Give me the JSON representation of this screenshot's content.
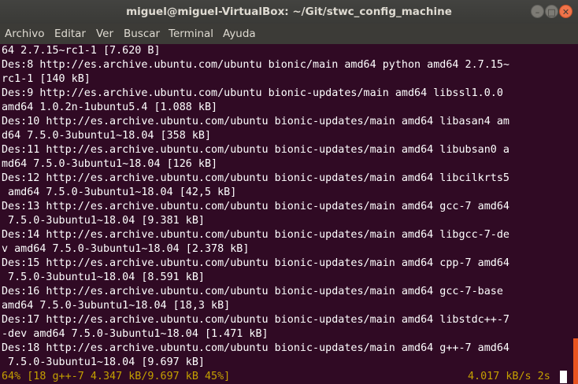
{
  "window": {
    "title": "miguel@miguel-VirtualBox: ~/Git/stwc_config_machine"
  },
  "window_controls": {
    "minimize_glyph": "–",
    "maximize_glyph": "□",
    "close_glyph": "✕"
  },
  "menubar": {
    "items": [
      "Archivo",
      "Editar",
      "Ver",
      "Buscar",
      "Terminal",
      "Ayuda"
    ]
  },
  "terminal": {
    "lines": [
      "64 2.7.15~rc1-1 [7.620 B]",
      "Des:8 http://es.archive.ubuntu.com/ubuntu bionic/main amd64 python amd64 2.7.15~",
      "rc1-1 [140 kB]",
      "Des:9 http://es.archive.ubuntu.com/ubuntu bionic-updates/main amd64 libssl1.0.0",
      "amd64 1.0.2n-1ubuntu5.4 [1.088 kB]",
      "Des:10 http://es.archive.ubuntu.com/ubuntu bionic-updates/main amd64 libasan4 am",
      "d64 7.5.0-3ubuntu1~18.04 [358 kB]",
      "Des:11 http://es.archive.ubuntu.com/ubuntu bionic-updates/main amd64 libubsan0 a",
      "md64 7.5.0-3ubuntu1~18.04 [126 kB]",
      "Des:12 http://es.archive.ubuntu.com/ubuntu bionic-updates/main amd64 libcilkrts5",
      " amd64 7.5.0-3ubuntu1~18.04 [42,5 kB]",
      "Des:13 http://es.archive.ubuntu.com/ubuntu bionic-updates/main amd64 gcc-7 amd64",
      " 7.5.0-3ubuntu1~18.04 [9.381 kB]",
      "Des:14 http://es.archive.ubuntu.com/ubuntu bionic-updates/main amd64 libgcc-7-de",
      "v amd64 7.5.0-3ubuntu1~18.04 [2.378 kB]",
      "Des:15 http://es.archive.ubuntu.com/ubuntu bionic-updates/main amd64 cpp-7 amd64",
      " 7.5.0-3ubuntu1~18.04 [8.591 kB]",
      "Des:16 http://es.archive.ubuntu.com/ubuntu bionic-updates/main amd64 gcc-7-base",
      "amd64 7.5.0-3ubuntu1~18.04 [18,3 kB]",
      "Des:17 http://es.archive.ubuntu.com/ubuntu bionic-updates/main amd64 libstdc++-7",
      "-dev amd64 7.5.0-3ubuntu1~18.04 [1.471 kB]",
      "Des:18 http://es.archive.ubuntu.com/ubuntu bionic-updates/main amd64 g++-7 amd64",
      " 7.5.0-3ubuntu1~18.04 [9.697 kB]"
    ],
    "status_left": "64% [18 g++-7 4.347 kB/9.697 kB 45%]",
    "status_right": "4.017 kB/s 2s"
  },
  "colors": {
    "background": "#300a24",
    "foreground": "#ffffff",
    "status_text": "#c4a000",
    "scrollbar_thumb": "#e95420",
    "titlebar": "#3c3b37",
    "close_button": "#f0744a"
  }
}
